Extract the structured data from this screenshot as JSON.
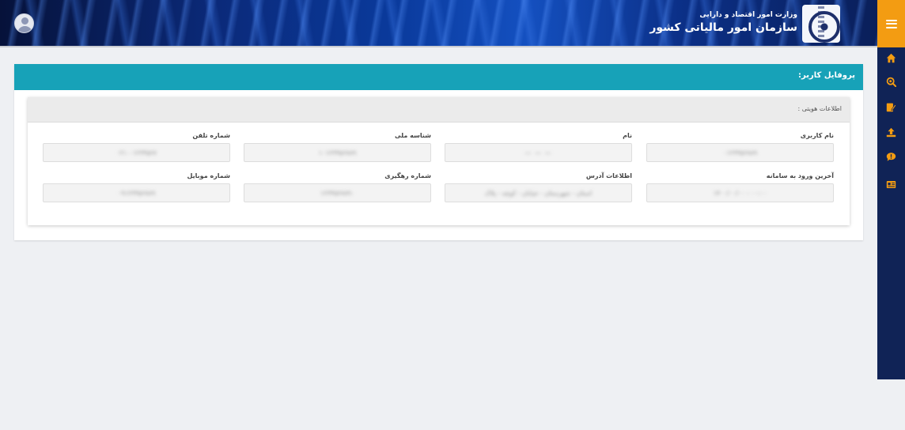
{
  "header": {
    "org_line1": "وزارت امور اقتصاد و دارایی",
    "org_line2": "سازمان امور مالیاتی کشور"
  },
  "sidebar": {
    "icons": [
      {
        "name": "home-icon"
      },
      {
        "name": "search-icon"
      },
      {
        "name": "edit-icon"
      },
      {
        "name": "upload-icon"
      },
      {
        "name": "message-icon"
      },
      {
        "name": "id-card-icon"
      }
    ],
    "accent": "#f39c12",
    "bg": "#102356"
  },
  "panel": {
    "title": "پروفایل کاربر:",
    "card_title": "اطلاعات هویتی :",
    "fields": {
      "username": {
        "label": "نام کاربری",
        "value": "۰۱۲۳۴۵۶۷۸۹"
      },
      "name": {
        "label": "نام",
        "value": "— — —"
      },
      "national_id": {
        "label": "شناسه ملی",
        "value": "۱۰۱۲۳۴۵۶۷۸۹"
      },
      "phone": {
        "label": "شماره تلفن",
        "value": "۰۲۱ - ۱۲۳۴۵۶۷"
      },
      "last_login": {
        "label": "آخرین ورود به سامانه",
        "value": "۱۴۰۰/۰۰/۰۰ - ۰۰:۰۰"
      },
      "address": {
        "label": "اطلاعات آدرس",
        "value": "استان - شهرستان - خیابان - کوچه - پلاک"
      },
      "tracking": {
        "label": "شماره رهگیری",
        "value": "۱۲۳۴۵۶۷۸۹۰"
      },
      "mobile": {
        "label": "شماره موبایل",
        "value": "۰۹۱۲۳۴۵۶۷۸۹"
      }
    },
    "header_color": "#17a2b8"
  }
}
